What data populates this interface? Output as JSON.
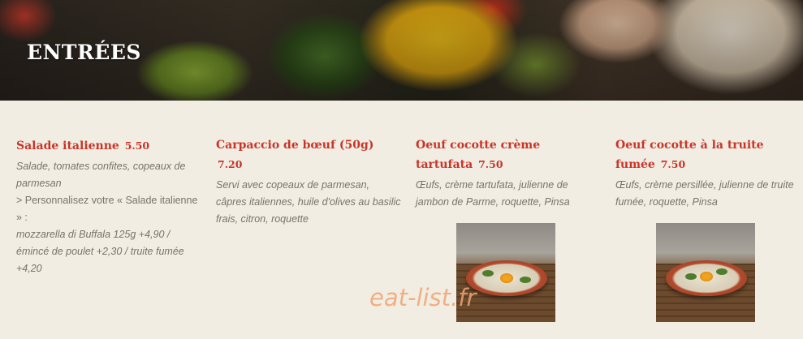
{
  "section": {
    "title": "ENTRÉES"
  },
  "items": [
    {
      "name": "Salade italienne",
      "price": "5.50",
      "desc": "Salade, tomates confites, copeaux de parmesan",
      "note": "> Personnalisez votre « Salade italienne » :",
      "extras": "mozzarella di Buffala 125g +4,90 / émincé de poulet +2,30 / truite fumée +4,20"
    },
    {
      "name": "Carpaccio de bœuf (50g)",
      "price": "7.20",
      "desc": "Servi avec copeaux de parmesan, câpres italiennes, huile d'olives au basilic frais, citron, roquette"
    },
    {
      "name": "Oeuf cocotte crème tartufata",
      "price": "7.50",
      "desc": "Œufs, crème tartufata, julienne de jambon de Parme, roquette, Pinsa"
    },
    {
      "name": "Oeuf cocotte à la truite fumée",
      "price": "7.50",
      "desc": "Œufs, crème persillée, julienne de truite fumée, roquette, Pinsa"
    }
  ],
  "watermark": "eat-list.fr",
  "colors": {
    "accent": "#c8352a",
    "text_muted": "#7a726a",
    "background": "#f1ede2"
  }
}
